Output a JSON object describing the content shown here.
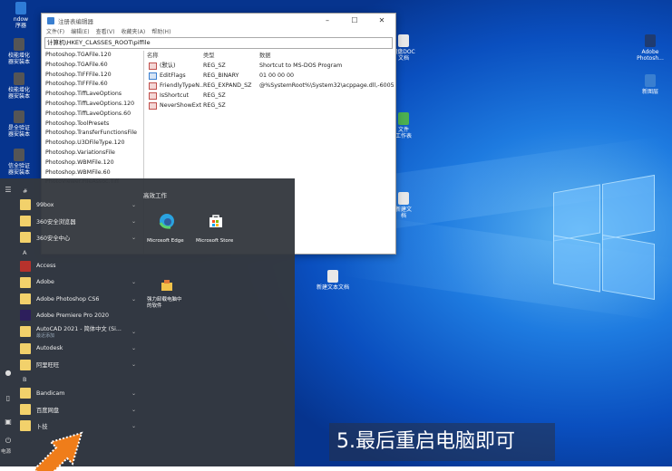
{
  "desktop": {
    "icons_left": [
      {
        "label": "ndow\n序器",
        "color": "#2e7bd6"
      },
      {
        "label": "校能增化\n器安装本",
        "color": "#555"
      },
      {
        "label": "校能增化\n器安装本",
        "color": "#555"
      },
      {
        "label": "是全验证\n器安装本",
        "color": "#555"
      },
      {
        "label": "信全验证\n器安装本",
        "color": "#555"
      }
    ],
    "icons_right": [
      {
        "label": "Adobe\nPhotosh...",
        "color": "#1f3b70"
      },
      {
        "label": "新图层",
        "color": "#3a7fd0"
      }
    ],
    "icons_middle": [
      {
        "label": "网盘DOC\n文档",
        "color": "#e8e8e8"
      },
      {
        "label": "文件\n工作表",
        "color": "#4caf50"
      },
      {
        "label": "新建文\n档",
        "color": "#e8e8e8"
      },
      {
        "label": "新建文本文档",
        "color": "#e8e8e8"
      }
    ]
  },
  "regedit": {
    "title": "注册表编辑器",
    "menus": [
      "文件(F)",
      "编辑(E)",
      "查看(V)",
      "收藏夹(A)",
      "帮助(H)"
    ],
    "address": "计算机\\HKEY_CLASSES_ROOT\\piffile",
    "tree": [
      "Photoshop.TGAFile.120",
      "Photoshop.TGAFile.60",
      "Photoshop.TIFFFile.120",
      "Photoshop.TIFFFile.60",
      "Photoshop.TiffLaveOptions",
      "Photoshop.TiffLaveOptions.120",
      "Photoshop.TiffLaveOptions.60",
      "Photoshop.ToolPresets",
      "Photoshop.TransferFunctionsFile",
      "Photoshop.U3DFileType.120",
      "Photoshop.VariationsFile",
      "Photoshop.WBMFile.120",
      "Photoshop.WBMFile.60",
      "PhotoViewer.FileAssoc.Tiff"
    ],
    "columns": [
      "名称",
      "类型",
      "数据"
    ],
    "rows": [
      {
        "name": "(默认)",
        "type": "REG_SZ",
        "data": "Shortcut to MS-DOS Program",
        "icon": "string"
      },
      {
        "name": "EditFlags",
        "type": "REG_BINARY",
        "data": "01 00 00 00",
        "icon": "binary"
      },
      {
        "name": "FriendlyTypeN...",
        "type": "REG_EXPAND_SZ",
        "data": "@%SystemRoot%\\System32\\acppage.dll,-6005",
        "icon": "string"
      },
      {
        "name": "IsShortcut",
        "type": "REG_SZ",
        "data": "",
        "icon": "string"
      },
      {
        "name": "NeverShowExt",
        "type": "REG_SZ",
        "data": "",
        "icon": "string"
      }
    ]
  },
  "start_menu": {
    "rail_bottom_label": "电源",
    "apps": [
      {
        "kind": "letter",
        "text": "#"
      },
      {
        "kind": "app",
        "name": "99box",
        "chev": true,
        "color": "#f2d16b"
      },
      {
        "kind": "app",
        "name": "360安全浏览器",
        "chev": true,
        "color": "#f2d16b"
      },
      {
        "kind": "app",
        "name": "360安全中心",
        "chev": true,
        "color": "#f2d16b"
      },
      {
        "kind": "letter",
        "text": "A"
      },
      {
        "kind": "app",
        "name": "Access",
        "chev": false,
        "color": "#b7322c"
      },
      {
        "kind": "app",
        "name": "Adobe",
        "chev": true,
        "color": "#f2d16b"
      },
      {
        "kind": "app",
        "name": "Adobe Photoshop CS6",
        "chev": true,
        "color": "#f2d16b"
      },
      {
        "kind": "app",
        "name": "Adobe Premiere Pro 2020",
        "chev": false,
        "color": "#2d1f5c"
      },
      {
        "kind": "app",
        "name": "AutoCAD 2021 - 简体中文 (Si...",
        "sub": "最近添加",
        "chev": true,
        "color": "#f2d16b"
      },
      {
        "kind": "app",
        "name": "Autodesk",
        "chev": true,
        "color": "#f2d16b"
      },
      {
        "kind": "app",
        "name": "阿里旺旺",
        "chev": true,
        "color": "#f2d16b"
      },
      {
        "kind": "letter",
        "text": "B"
      },
      {
        "kind": "app",
        "name": "Bandicam",
        "chev": true,
        "color": "#f2d16b"
      },
      {
        "kind": "app",
        "name": "百度网盘",
        "chev": true,
        "color": "#f2d16b"
      },
      {
        "kind": "app",
        "name": "卜技",
        "chev": true,
        "color": "#f2d16b"
      }
    ],
    "tiles_title": "高效工作",
    "tiles": [
      {
        "label": "Microsoft Edge",
        "color": "#2f5f9e",
        "icon": "edge-icon"
      },
      {
        "label": "Microsoft Store",
        "color": "#2e7fd9",
        "icon": "store-icon"
      },
      {
        "label": "强力卸载电脑中\n的软件",
        "color": "#2e7fd9",
        "icon": "uninstall-icon"
      }
    ]
  },
  "caption": "5.最后重启电脑即可"
}
